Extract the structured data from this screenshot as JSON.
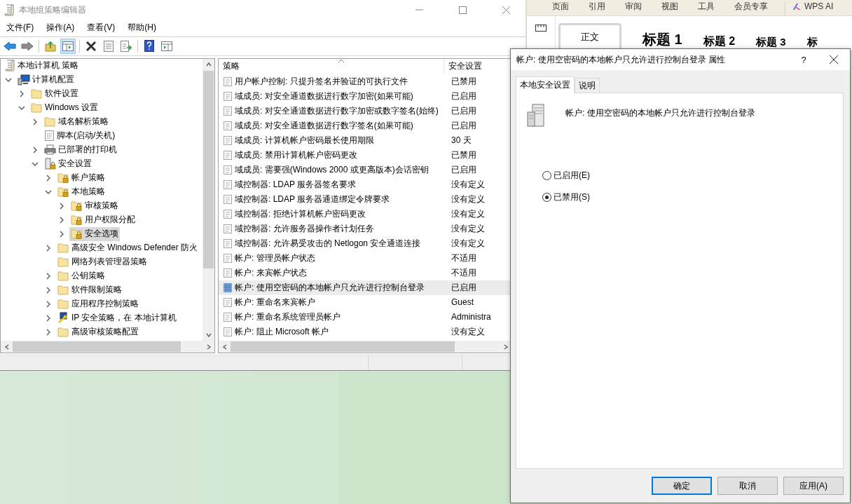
{
  "editor": {
    "title": "本地组策略编辑器",
    "menu": [
      "文件(F)",
      "操作(A)",
      "查看(V)",
      "帮助(H)"
    ],
    "tree": {
      "label": "本地计算机 策略",
      "kind": "policy",
      "selected": false,
      "children": [
        {
          "label": "计算机配置",
          "kind": "computer",
          "expanded": true,
          "selected": false,
          "children": [
            {
              "label": "软件设置",
              "kind": "folder",
              "expanded": false,
              "selected": false
            },
            {
              "label": "Windows 设置",
              "kind": "folder",
              "expanded": true,
              "selected": false,
              "children": [
                {
                  "label": "域名解析策略",
                  "kind": "folder",
                  "expanded": false,
                  "selected": false
                },
                {
                  "label": "脚本(启动/关机)",
                  "kind": "script",
                  "selected": false
                },
                {
                  "label": "已部署的打印机",
                  "kind": "printer",
                  "expanded": false,
                  "selected": false
                },
                {
                  "label": "安全设置",
                  "kind": "security",
                  "expanded": true,
                  "selected": false,
                  "children": [
                    {
                      "label": "帐户策略",
                      "kind": "lockfolder",
                      "expanded": false,
                      "selected": false
                    },
                    {
                      "label": "本地策略",
                      "kind": "lockfolder",
                      "expanded": true,
                      "selected": false,
                      "children": [
                        {
                          "label": "审核策略",
                          "kind": "lockfolder",
                          "expanded": false,
                          "selected": false
                        },
                        {
                          "label": "用户权限分配",
                          "kind": "lockfolder",
                          "expanded": false,
                          "selected": false
                        },
                        {
                          "label": "安全选项",
                          "kind": "lockfolder",
                          "expanded": false,
                          "selected": true
                        }
                      ]
                    },
                    {
                      "label": "高级安全 Windows Defender 防火",
                      "kind": "folder",
                      "expanded": false,
                      "selected": false
                    },
                    {
                      "label": "网络列表管理器策略",
                      "kind": "folder",
                      "selected": false
                    },
                    {
                      "label": "公钥策略",
                      "kind": "folder",
                      "expanded": false,
                      "selected": false
                    },
                    {
                      "label": "软件限制策略",
                      "kind": "folder",
                      "expanded": false,
                      "selected": false
                    },
                    {
                      "label": "应用程序控制策略",
                      "kind": "folder",
                      "expanded": false,
                      "selected": false
                    },
                    {
                      "label": "IP 安全策略，在 本地计算机",
                      "kind": "ipsec",
                      "expanded": false,
                      "selected": false
                    },
                    {
                      "label": "高级审核策略配置",
                      "kind": "folder",
                      "expanded": false,
                      "selected": false
                    }
                  ]
                }
              ]
            }
          ]
        }
      ]
    },
    "columns": [
      "策略",
      "安全设置"
    ],
    "rows": [
      {
        "policy": "用户帐户控制: 只提升签名并验证的可执行文件",
        "setting": "已禁用",
        "selected": false
      },
      {
        "policy": "域成员: 对安全通道数据进行数字加密(如果可能)",
        "setting": "已启用",
        "selected": false
      },
      {
        "policy": "域成员: 对安全通道数据进行数字加密或数字签名(始终)",
        "setting": "已启用",
        "selected": false
      },
      {
        "policy": "域成员: 对安全通道数据进行数字签名(如果可能)",
        "setting": "已启用",
        "selected": false
      },
      {
        "policy": "域成员: 计算机帐户密码最长使用期限",
        "setting": "30 天",
        "selected": false
      },
      {
        "policy": "域成员: 禁用计算机帐户密码更改",
        "setting": "已禁用",
        "selected": false
      },
      {
        "policy": "域成员: 需要强(Windows 2000 或更高版本)会话密钥",
        "setting": "已启用",
        "selected": false
      },
      {
        "policy": "域控制器: LDAP 服务器签名要求",
        "setting": "没有定义",
        "selected": false
      },
      {
        "policy": "域控制器: LDAP 服务器通道绑定令牌要求",
        "setting": "没有定义",
        "selected": false
      },
      {
        "policy": "域控制器: 拒绝计算机帐户密码更改",
        "setting": "没有定义",
        "selected": false
      },
      {
        "policy": "域控制器: 允许服务器操作者计划任务",
        "setting": "没有定义",
        "selected": false
      },
      {
        "policy": "域控制器:  允许易受攻击的 Netlogon 安全通道连接",
        "setting": "没有定义",
        "selected": false
      },
      {
        "policy": "帐户: 管理员帐户状态",
        "setting": "不适用",
        "selected": false
      },
      {
        "policy": "帐户: 来宾帐户状态",
        "setting": "不适用",
        "selected": false
      },
      {
        "policy": "帐户: 使用空密码的本地帐户只允许进行控制台登录",
        "setting": "已启用",
        "selected": true
      },
      {
        "policy": "帐户: 重命名来宾帐户",
        "setting": "Guest",
        "selected": false
      },
      {
        "policy": "帐户: 重命名系统管理员帐户",
        "setting": "Administra",
        "selected": false
      },
      {
        "policy": "帐户: 阻止 Microsoft 帐户",
        "setting": "没有定义",
        "selected": false
      }
    ]
  },
  "wps": {
    "tabs": [
      "页面",
      "引用",
      "审阅",
      "视图",
      "工具",
      "会员专享"
    ],
    "ai_label": "WPS AI",
    "styles": [
      {
        "label": "正文",
        "kind": "normal"
      },
      {
        "label": "标题 1",
        "kind": "h1"
      },
      {
        "label": "标题 2",
        "kind": "h2"
      },
      {
        "label": "标题 3",
        "kind": "h3"
      },
      {
        "label": "标",
        "kind": "h4"
      }
    ]
  },
  "dialog": {
    "title": "帐户: 使用空密码的本地帐户只允许进行控制台登录 属性",
    "help": "?",
    "tabs": [
      {
        "label": "本地安全设置",
        "selected": true
      },
      {
        "label": "说明",
        "selected": false
      }
    ],
    "heading": "帐户: 使用空密码的本地帐户只允许进行控制台登录",
    "options": [
      {
        "label": "已启用(E)",
        "selected": false
      },
      {
        "label": "已禁用(S)",
        "selected": true
      }
    ],
    "buttons": [
      {
        "label": "确定",
        "default": true
      },
      {
        "label": "取消",
        "default": false
      },
      {
        "label": "应用(A)",
        "default": false
      }
    ]
  }
}
